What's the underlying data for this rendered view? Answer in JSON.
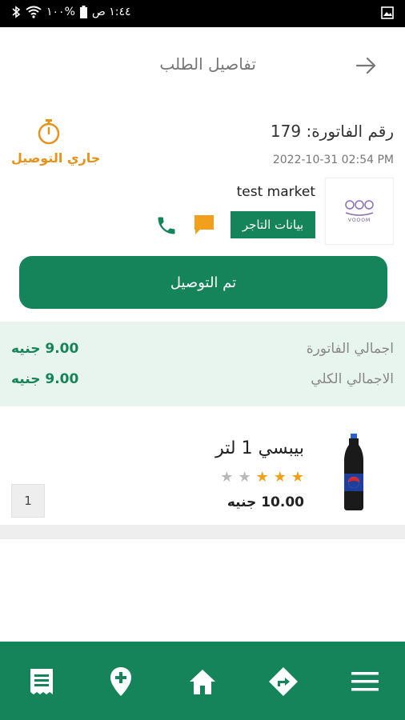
{
  "status_bar": {
    "time": "١:٤٤ ص",
    "battery": "%١٠٠"
  },
  "header": {
    "title": "تفاصيل الطلب",
    "back_icon": "arrow-right-icon"
  },
  "order": {
    "invoice_label": "رقم الفاتورة: 179",
    "date": "2022-10-31 02:54 PM",
    "status": "جاري التوصيل",
    "status_color": "#e6921b"
  },
  "merchant": {
    "name": "test market",
    "info_button": "بيانات التاجر",
    "logo_text": "VOOOM"
  },
  "actions": {
    "delivered_button": "تم التوصيل"
  },
  "totals": {
    "rows": [
      {
        "label": "اجمالي الفاتورة",
        "value": "9.00 جنيه"
      },
      {
        "label": "الاجمالي الكلي",
        "value": "9.00 جنيه"
      }
    ]
  },
  "product": {
    "name": "بيبسي 1 لتر",
    "rating": 3,
    "rating_max": 5,
    "price": "10.00 جنيه",
    "quantity": "1"
  },
  "bottom_nav": {
    "items": [
      "receipt-icon",
      "map-pin-add-icon",
      "home-icon",
      "directions-icon",
      "menu-icon"
    ]
  },
  "colors": {
    "primary": "#16845a",
    "accent": "#e6921b",
    "light_green_bg": "#e8f4ee"
  }
}
